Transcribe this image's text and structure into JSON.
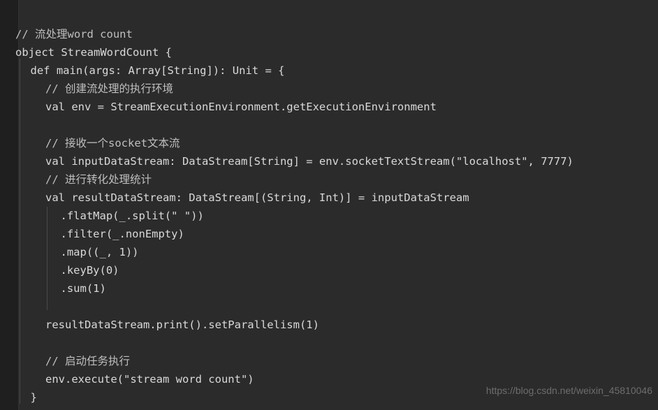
{
  "editor": {
    "background_color": "#2b2b2b",
    "gutter_color": "#1f1f1f",
    "text_color": "#d9d9d9",
    "comment_color": "#bfbfbf",
    "indent_guide_color": "#4a4a4a",
    "language": "Scala",
    "lines": [
      {
        "n": 1,
        "indent": 0,
        "type": "comment",
        "text": "// 流处理word count"
      },
      {
        "n": 2,
        "indent": 0,
        "type": "code",
        "text": "object StreamWordCount {"
      },
      {
        "n": 3,
        "indent": 1,
        "type": "code",
        "text": "def main(args: Array[String]): Unit = {"
      },
      {
        "n": 4,
        "indent": 2,
        "type": "comment",
        "text": "// 创建流处理的执行环境"
      },
      {
        "n": 5,
        "indent": 2,
        "type": "code",
        "text": "val env = StreamExecutionEnvironment.getExecutionEnvironment"
      },
      {
        "n": 6,
        "indent": 0,
        "type": "blank",
        "text": ""
      },
      {
        "n": 7,
        "indent": 2,
        "type": "comment",
        "text": "// 接收一个socket文本流"
      },
      {
        "n": 8,
        "indent": 2,
        "type": "code",
        "text": "val inputDataStream: DataStream[String] = env.socketTextStream(\"localhost\", 7777)"
      },
      {
        "n": 9,
        "indent": 2,
        "type": "comment",
        "text": "// 进行转化处理统计"
      },
      {
        "n": 10,
        "indent": 2,
        "type": "code",
        "text": "val resultDataStream: DataStream[(String, Int)] = inputDataStream"
      },
      {
        "n": 11,
        "indent": 3,
        "type": "code",
        "text": ".flatMap(_.split(\" \"))"
      },
      {
        "n": 12,
        "indent": 3,
        "type": "code",
        "text": ".filter(_.nonEmpty)"
      },
      {
        "n": 13,
        "indent": 3,
        "type": "code",
        "text": ".map((_, 1))"
      },
      {
        "n": 14,
        "indent": 3,
        "type": "code",
        "text": ".keyBy(0)"
      },
      {
        "n": 15,
        "indent": 3,
        "type": "code",
        "text": ".sum(1)"
      },
      {
        "n": 16,
        "indent": 0,
        "type": "blank",
        "text": ""
      },
      {
        "n": 17,
        "indent": 2,
        "type": "code",
        "text": "resultDataStream.print().setParallelism(1)"
      },
      {
        "n": 18,
        "indent": 0,
        "type": "blank",
        "text": ""
      },
      {
        "n": 19,
        "indent": 2,
        "type": "comment",
        "text": "// 启动任务执行"
      },
      {
        "n": 20,
        "indent": 2,
        "type": "code",
        "text": "env.execute(\"stream word count\")"
      },
      {
        "n": 21,
        "indent": 1,
        "type": "code",
        "text": "}"
      }
    ]
  },
  "watermark": {
    "text": "https://blog.csdn.net/weixin_45810046"
  }
}
